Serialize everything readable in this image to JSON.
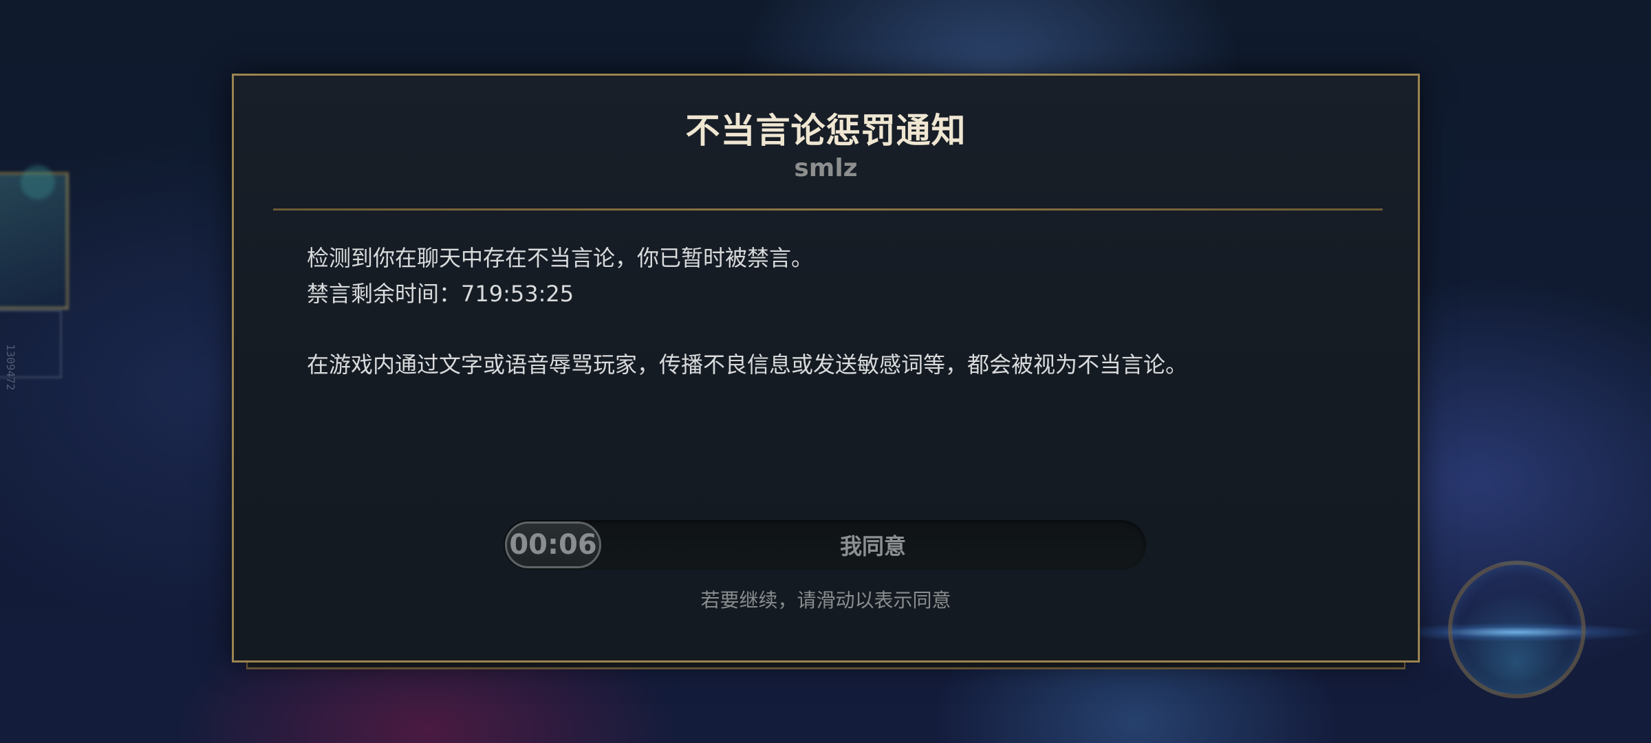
{
  "background": {
    "side_text": "1309472"
  },
  "dialog": {
    "title": "不当言论惩罚通知",
    "username": "smlz",
    "message_line1": "检测到你在聊天中存在不当言论，你已暂时被禁言。",
    "message_line2": "禁言剩余时间：719:53:25",
    "message_line3": "在游戏内通过文字或语音辱骂玩家，传播不良信息或发送敏感词等，都会被视为不当言论。",
    "slider": {
      "countdown": "00:06",
      "label": "我同意",
      "hint": "若要继续，请滑动以表示同意"
    }
  },
  "colors": {
    "border_gold": "#9c8450",
    "title": "#efe6d2",
    "body_text": "#d9dbdc",
    "muted_text": "#8c9092"
  }
}
